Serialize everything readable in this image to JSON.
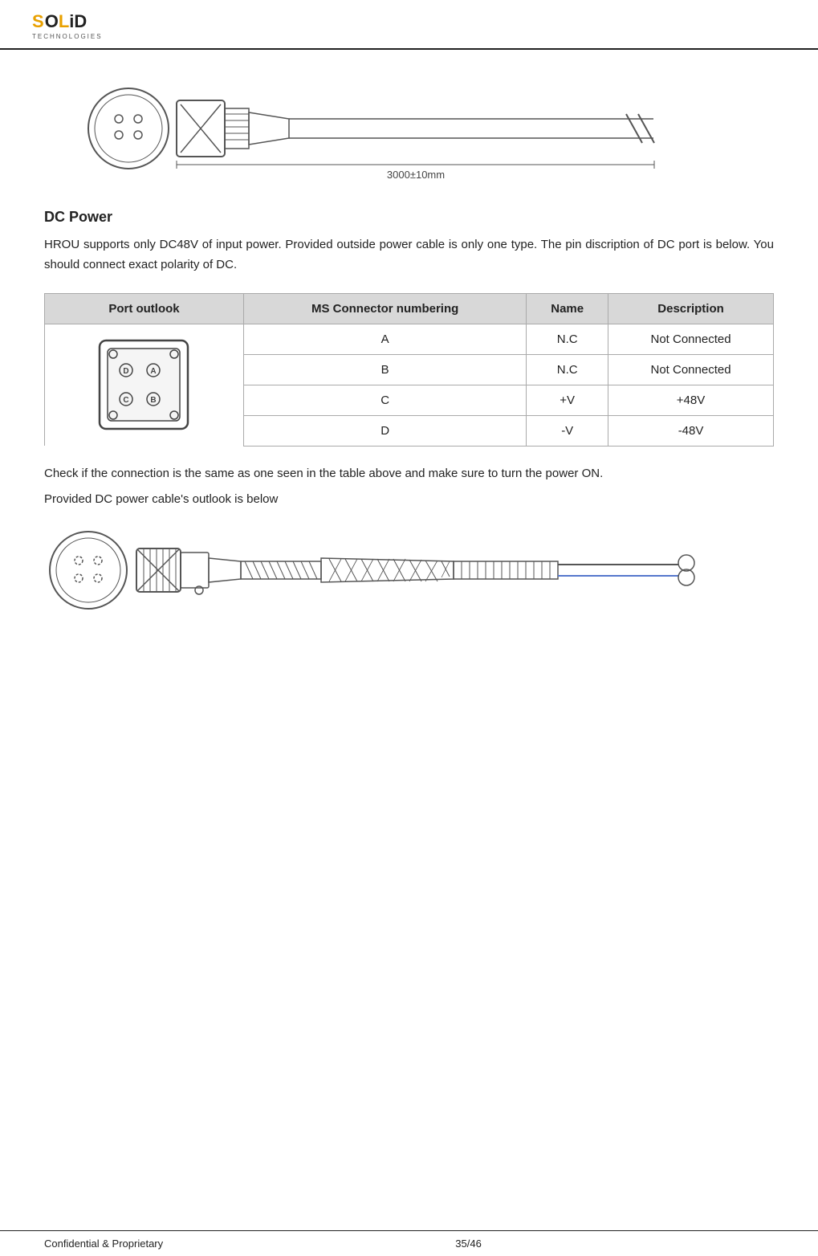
{
  "header": {
    "logo": {
      "letters": [
        "S",
        "O",
        "L",
        "i",
        "D"
      ],
      "tagline": "TECHNOLOGIES"
    }
  },
  "cable_diagram_top": {
    "label": "3000±10mm",
    "alt_text": "DC power cable diagram showing connector and cable length"
  },
  "dc_power": {
    "title": "DC Power",
    "description": "HROU  supports  only  DC48V  of  input  power.  Provided  outside  power  cable  is  only  one  type.  The  pin discription of DC port is below. You should connect exact polarity of DC."
  },
  "table": {
    "headers": [
      "Port outlook",
      "MS Connector numbering",
      "Name",
      "Description"
    ],
    "rows": [
      {
        "connector": "A",
        "name": "N.C",
        "description": "Not Connected"
      },
      {
        "connector": "B",
        "name": "N.C",
        "description": "Not Connected"
      },
      {
        "connector": "C",
        "name": "+V",
        "description": "+48V"
      },
      {
        "connector": "D",
        "name": "-V",
        "description": "-48V"
      }
    ]
  },
  "after_table": {
    "line1": "Check if the connection is the same as one seen in the table above and make sure to turn the power ON.",
    "line2": "Provided DC power cable's outlook is below"
  },
  "footer": {
    "left": "Confidential & Proprietary",
    "center": "35/46"
  }
}
